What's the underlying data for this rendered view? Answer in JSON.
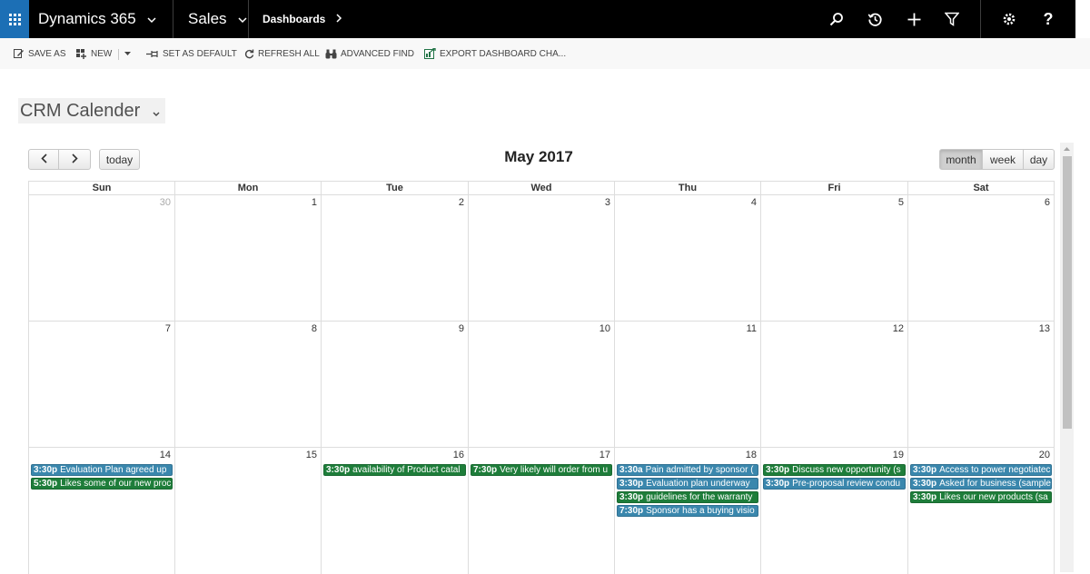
{
  "nav": {
    "app_name": "Dynamics 365",
    "area": "Sales",
    "section": "Dashboards",
    "icons": [
      "waffle-icon",
      "search-icon",
      "history-icon",
      "plus-icon",
      "filter-icon",
      "gear-icon",
      "help-icon"
    ]
  },
  "commands": {
    "save_as": "SAVE AS",
    "new": "NEW",
    "set_as_default": "SET AS DEFAULT",
    "refresh_all": "REFRESH ALL",
    "advanced_find": "ADVANCED FIND",
    "export": "EXPORT DASHBOARD CHA..."
  },
  "dashboard": {
    "title": "CRM Calender"
  },
  "calendar": {
    "title": "May 2017",
    "prev_label": "<",
    "next_label": ">",
    "today_label": "today",
    "views": {
      "month": "month",
      "week": "week",
      "day": "day"
    },
    "active_view": "month",
    "days_of_week": [
      "Sun",
      "Mon",
      "Tue",
      "Wed",
      "Thu",
      "Fri",
      "Sat"
    ],
    "weeks": [
      [
        {
          "day": "30",
          "other": true,
          "events": []
        },
        {
          "day": "1",
          "events": []
        },
        {
          "day": "2",
          "events": []
        },
        {
          "day": "3",
          "events": []
        },
        {
          "day": "4",
          "events": []
        },
        {
          "day": "5",
          "events": []
        },
        {
          "day": "6",
          "events": []
        }
      ],
      [
        {
          "day": "7",
          "events": []
        },
        {
          "day": "8",
          "events": []
        },
        {
          "day": "9",
          "events": []
        },
        {
          "day": "10",
          "events": []
        },
        {
          "day": "11",
          "events": []
        },
        {
          "day": "12",
          "events": []
        },
        {
          "day": "13",
          "events": []
        }
      ],
      [
        {
          "day": "14",
          "events": [
            {
              "time": "3:30p",
              "text": "Evaluation Plan agreed up",
              "color": "blue"
            },
            {
              "time": "5:30p",
              "text": "Likes some of our new proc",
              "color": "green"
            }
          ]
        },
        {
          "day": "15",
          "events": []
        },
        {
          "day": "16",
          "events": [
            {
              "time": "3:30p",
              "text": "availability of Product catal",
              "color": "green"
            }
          ]
        },
        {
          "day": "17",
          "events": [
            {
              "time": "7:30p",
              "text": "Very likely will order from u",
              "color": "green"
            }
          ]
        },
        {
          "day": "18",
          "events": [
            {
              "time": "3:30a",
              "text": "Pain admitted by sponsor (",
              "color": "blue"
            },
            {
              "time": "3:30p",
              "text": "Evaluation plan underway",
              "color": "blue"
            },
            {
              "time": "3:30p",
              "text": "guidelines for the warranty",
              "color": "green"
            },
            {
              "time": "7:30p",
              "text": "Sponsor has a buying visio",
              "color": "blue"
            }
          ]
        },
        {
          "day": "19",
          "events": [
            {
              "time": "3:30p",
              "text": "Discuss new opportunity (s",
              "color": "green"
            },
            {
              "time": "3:30p",
              "text": "Pre-proposal review condu",
              "color": "blue"
            }
          ]
        },
        {
          "day": "20",
          "events": [
            {
              "time": "3:30p",
              "text": "Access to power negotiatec",
              "color": "blue"
            },
            {
              "time": "3:30p",
              "text": "Asked for business (sample",
              "color": "blue"
            },
            {
              "time": "3:30p",
              "text": "Likes our new products (sa",
              "color": "green"
            }
          ]
        }
      ]
    ]
  },
  "colors": {
    "waffle": "#1c6fb5",
    "event_blue": "#3a87ad",
    "event_green": "#1e7d3a",
    "nav_bg": "#000000"
  }
}
